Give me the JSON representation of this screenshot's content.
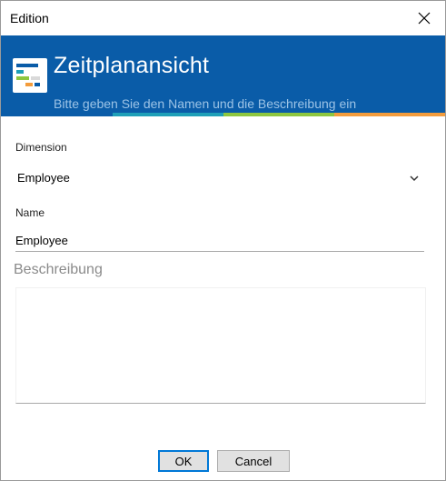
{
  "window": {
    "title": "Edition"
  },
  "banner": {
    "title": "Zeitplanansicht",
    "subtitle": "Bitte geben Sie den Namen und die Beschreibung ein",
    "accent_colors": [
      "#0a5ca8",
      "#1e9fb8",
      "#8dc63f",
      "#f39c3c"
    ],
    "background_color": "#0a5ca8",
    "icon": "schedule-view-icon"
  },
  "form": {
    "dimension": {
      "label": "Dimension",
      "value": "Employee",
      "icon": "chevron-down-icon"
    },
    "name": {
      "label": "Name",
      "value": "Employee"
    },
    "description": {
      "label": "Beschreibung",
      "value": ""
    }
  },
  "buttons": {
    "ok_label": "OK",
    "cancel_label": "Cancel"
  }
}
